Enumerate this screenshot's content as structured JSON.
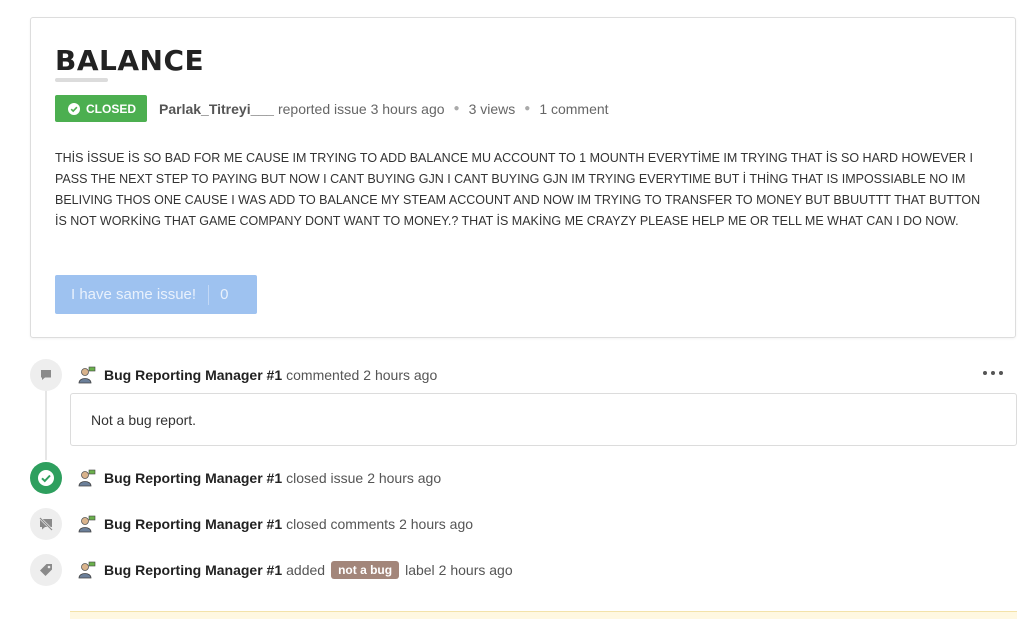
{
  "issue": {
    "title": "BALANCE",
    "status": "CLOSED",
    "author": "Parlak_Titreyi___",
    "reported_text": "reported issue 3 hours ago",
    "views": "3 views",
    "comments": "1 comment",
    "body": "THİS İSSUE İS SO BAD FOR ME CAUSE IM TRYING TO ADD BALANCE MU ACCOUNT TO 1 MOUNTH EVERYTİME IM TRYING THAT İS SO HARD HOWEVER I PASS THE NEXT STEP TO PAYING BUT NOW I CANT BUYING GJN I CANT BUYING GJN IM TRYING EVERYTIME BUT İ THİNG THAT IS IMPOSSIABLE NO IM BELIVING THOS ONE CAUSE I WAS ADD TO BALANCE MY STEAM ACCOUNT AND NOW IM TRYING TO TRANSFER TO MONEY BUT BBUUTTT THAT BUTTON İS NOT WORKİNG THAT GAME COMPANY DONT WANT TO MONEY.? THAT İS MAKİNG ME CRAYZY PLEASE HELP ME OR TELL ME WHAT CAN I DO NOW.",
    "same_issue_label": "I have same issue!",
    "same_issue_count": "0"
  },
  "timeline": {
    "comment": {
      "actor": "Bug Reporting Manager #1",
      "action": "commented",
      "time": "2 hours ago",
      "text": "Not a bug report."
    },
    "closed": {
      "actor": "Bug Reporting Manager #1",
      "action": "closed issue",
      "time": "2 hours ago"
    },
    "closed_comments": {
      "actor": "Bug Reporting Manager #1",
      "action": "closed comments",
      "time": "2 hours ago"
    },
    "label": {
      "actor": "Bug Reporting Manager #1",
      "action": "added",
      "label": "not a bug",
      "after": "label",
      "time": "2 hours ago"
    }
  },
  "colors": {
    "closed_badge": "#4caf50",
    "same_issue_button": "#9ec2f0",
    "label_chip": "#a3867a",
    "closed_icon": "#2e9f5e"
  },
  "icons": {
    "comment": "comment-icon",
    "closed": "check-circle-icon",
    "closed_comments": "comment-slash-icon",
    "label": "tag-icon",
    "more": "more-horizontal-icon"
  }
}
